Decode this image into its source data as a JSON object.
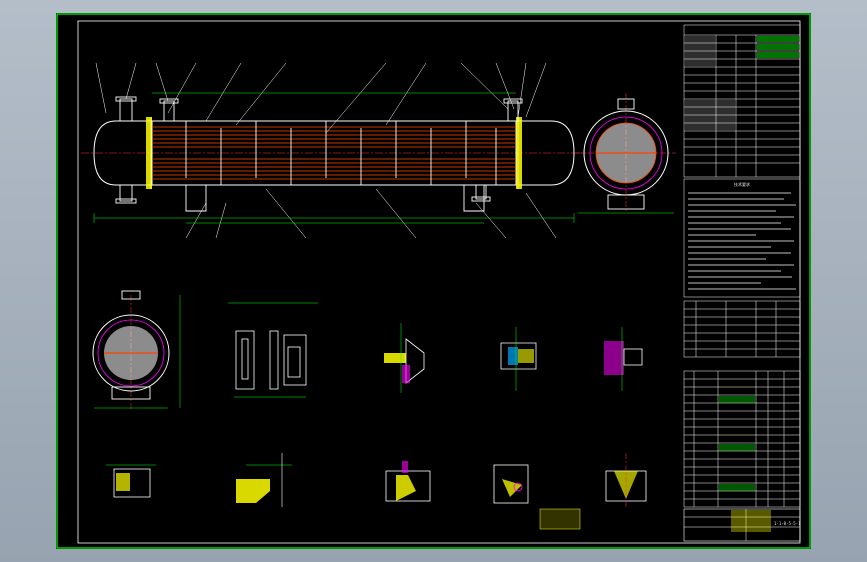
{
  "title_block": {
    "drawing_number": "1-1-0-5-5-1"
  },
  "notes_heading": "技术要求",
  "palette": {
    "background": "#000000",
    "frame": "#00ff00",
    "outline": "#ffffff",
    "centerline": "#ff3333",
    "dimension": "#00ff00",
    "hatch": "#ffff00",
    "section": "#ff00ff",
    "tubes": "#ff4400",
    "window": "#a6b1bd"
  },
  "icons": {
    "main_view": "heat-exchanger-front-view",
    "end_view": "tubesheet-end-view",
    "details": "weld-detail-sections"
  }
}
